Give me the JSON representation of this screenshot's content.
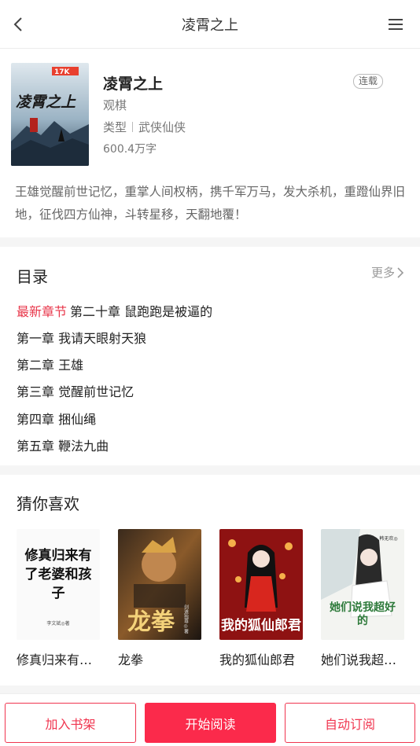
{
  "header": {
    "title": "凌霄之上"
  },
  "book": {
    "title": "凌霄之上",
    "status": "连载",
    "author": "观棋",
    "genre_label": "类型",
    "genre": "武侠仙侠",
    "word_count": "600.4万字",
    "description": "王雄觉醒前世记忆，重掌人间权柄，携千军万马，发大杀机，重蹬仙界旧地，征伐四方仙神，斗转星移，天翻地覆！",
    "cover": {
      "title_art": "凌霄之上",
      "badge": "17K"
    }
  },
  "toc": {
    "title": "目录",
    "more_label": "更多",
    "latest_label": "最新章节",
    "latest_chapter": "第二十章 鼠跑跑是被逼的",
    "chapters": [
      "第一章 我请天眼射天狼",
      "第二章 王雄",
      "第三章 觉醒前世记忆",
      "第四章 捆仙绳",
      "第五章 鞭法九曲"
    ]
  },
  "recommend": {
    "title": "猜你喜欢",
    "items": [
      {
        "name": "修真归来有…",
        "cover_art": "修真归来有了老婆和孩子",
        "cover_author": "李文斌◎著"
      },
      {
        "name": "龙拳",
        "cover_art": "龙拳",
        "cover_author": "剑道独尊◎著"
      },
      {
        "name": "我的狐仙郎君",
        "cover_art": "我的狐仙郎君",
        "cover_author": ""
      },
      {
        "name": "她们说我超…",
        "cover_art": "她们说我超好的",
        "cover_author": "韩无欢◎"
      }
    ]
  },
  "actions": {
    "add_shelf": "加入书架",
    "start_read": "开始阅读",
    "auto_subscribe": "自动订阅"
  },
  "colors": {
    "accent": "#fb2a4b",
    "latest": "#e8364a"
  }
}
